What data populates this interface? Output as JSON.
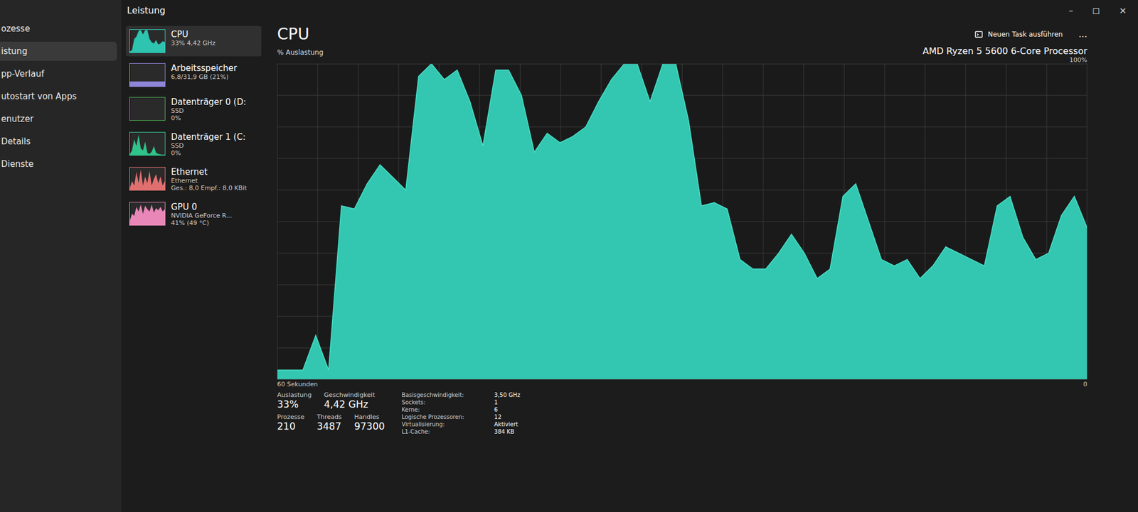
{
  "window": {
    "title": "Leistung",
    "controls": [
      "–",
      "◻",
      "×"
    ]
  },
  "nav": {
    "items": [
      {
        "label": "ozesse",
        "selected": false
      },
      {
        "label": "istung",
        "selected": true
      },
      {
        "label": "pp-Verlauf",
        "selected": false
      },
      {
        "label": "utostart von Apps",
        "selected": false
      },
      {
        "label": "enutzer",
        "selected": false
      },
      {
        "label": "Details",
        "selected": false
      },
      {
        "label": "Dienste",
        "selected": false
      }
    ]
  },
  "devices": [
    {
      "name": "CPU",
      "lines": [
        "33% 4,42 GHz"
      ],
      "selected": true,
      "color": "#2ec4b0",
      "spark": [
        5,
        10,
        60,
        70,
        95,
        100,
        80,
        98,
        100,
        60,
        45,
        40,
        55,
        35,
        40,
        50,
        45
      ]
    },
    {
      "name": "Arbeitsspeicher",
      "lines": [
        "6,8/31,9 GB (21%)"
      ],
      "selected": false,
      "color": "#8f86d9",
      "spark": [
        21,
        21,
        21,
        21,
        21,
        21,
        21,
        21,
        21,
        21,
        21,
        21,
        21,
        21,
        21,
        21,
        21
      ]
    },
    {
      "name": "Datenträger 0 (D:",
      "lines": [
        "SSD",
        "0%"
      ],
      "selected": false,
      "color": "#4caf50",
      "spark": [
        0,
        0,
        0,
        0,
        0,
        0,
        0,
        0,
        0,
        0,
        0,
        0,
        0,
        0,
        0,
        0,
        0
      ]
    },
    {
      "name": "Datenträger 1 (C:",
      "lines": [
        "SSD",
        "0%"
      ],
      "selected": false,
      "color": "#2ec48a",
      "spark": [
        5,
        20,
        70,
        40,
        90,
        30,
        20,
        60,
        10,
        5,
        15,
        40,
        10,
        5,
        3,
        2,
        2
      ]
    },
    {
      "name": "Ethernet",
      "lines": [
        "Ethernet",
        "Ges.: 8,0 Empf.: 8,0 KBit"
      ],
      "selected": false,
      "color": "#e0706f",
      "spark": [
        10,
        40,
        20,
        80,
        30,
        90,
        20,
        60,
        30,
        85,
        20,
        50,
        70,
        30,
        60,
        20,
        40
      ]
    },
    {
      "name": "GPU 0",
      "lines": [
        "NVIDIA GeForce R...",
        "41% (49 °C)"
      ],
      "selected": false,
      "color": "#e887b8",
      "spark": [
        20,
        50,
        40,
        80,
        60,
        90,
        50,
        85,
        70,
        60,
        90,
        55,
        75,
        65,
        80,
        60,
        70
      ]
    }
  ],
  "main": {
    "title": "CPU",
    "run_task": "Neuen Task ausführen",
    "more": "...",
    "subtitle": "% Auslastung",
    "processor": "AMD Ryzen 5 5600 6-Core Processor",
    "max": "100%",
    "x_start": "60 Sekunden",
    "x_end": "0"
  },
  "chart": {
    "values": [
      3,
      3,
      3,
      14,
      3,
      55,
      54,
      62,
      68,
      64,
      60,
      96,
      100,
      95,
      98,
      88,
      74,
      98,
      98,
      90,
      72,
      78,
      75,
      77,
      80,
      88,
      95,
      100,
      100,
      88,
      100,
      100,
      82,
      55,
      56,
      54,
      38,
      35,
      35,
      40,
      46,
      40,
      32,
      35,
      58,
      62,
      50,
      38,
      36,
      38,
      32,
      36,
      42,
      40,
      38,
      36,
      55,
      58,
      45,
      38,
      40,
      52,
      58,
      48
    ]
  },
  "stats": [
    [
      {
        "label": "Auslastung",
        "value": "33%"
      },
      {
        "label": "Geschwindigkeit",
        "value": "4,42 GHz"
      }
    ],
    [
      {
        "label": "Prozesse",
        "value": "210"
      },
      {
        "label": "Threads",
        "value": "3487"
      },
      {
        "label": "Handles",
        "value": "97300"
      }
    ]
  ],
  "specs": [
    {
      "label": "Basisgeschwindigkeit:",
      "value": "3,50 GHz"
    },
    {
      "label": "Sockets:",
      "value": "1"
    },
    {
      "label": "Kerne:",
      "value": "6"
    },
    {
      "label": "Logische Prozessoren:",
      "value": "12"
    },
    {
      "label": "Virtualisierung:",
      "value": "Aktiviert"
    },
    {
      "label": "L1-Cache:",
      "value": "384 KB"
    }
  ]
}
